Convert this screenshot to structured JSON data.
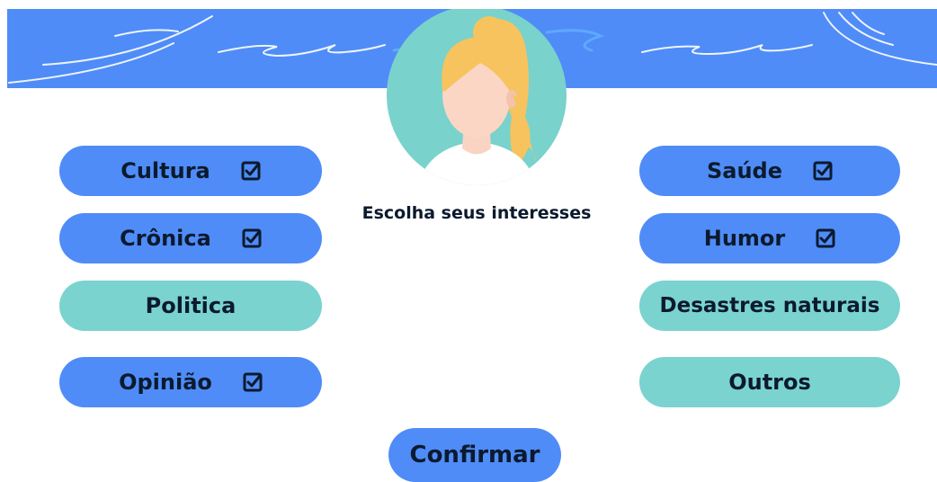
{
  "page": {
    "title": "Escolha seus interesses",
    "confirm_label": "Confirmar"
  },
  "interests": {
    "left": [
      {
        "label": "Cultura",
        "selected": true
      },
      {
        "label": "Crônica",
        "selected": true
      },
      {
        "label": "Politica",
        "selected": false
      },
      {
        "label": "Opinião",
        "selected": true
      }
    ],
    "right": [
      {
        "label": "Saúde",
        "selected": true
      },
      {
        "label": "Humor",
        "selected": true
      },
      {
        "label": "Desastres naturais",
        "selected": false
      },
      {
        "label": "Outros",
        "selected": false
      }
    ]
  },
  "icons": {
    "checkbox": "checkbox-checked-icon",
    "avatar": "user-avatar-icon"
  },
  "colors": {
    "selected": "#4f8cf7",
    "unselected": "#7ad3ce",
    "banner": "#4f8cf7",
    "text": "#0b1a2e"
  }
}
